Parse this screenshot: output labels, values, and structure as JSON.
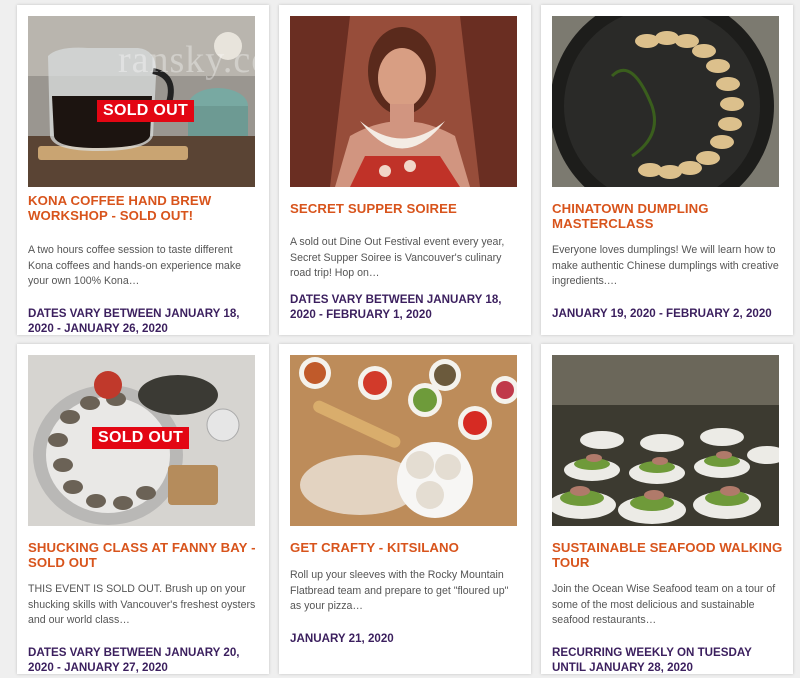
{
  "watermark": "ransky.com",
  "sold_badge": "SOLD OUT",
  "events": [
    {
      "title": "KONA COFFEE HAND BREW WORKSHOP - SOLD OUT!",
      "description": "A two hours coffee session to taste different Kona coffees and hands-on experience make your own 100% Kona…",
      "dates": "DATES VARY BETWEEN JANUARY 18, 2020 - JANUARY 26, 2020"
    },
    {
      "title": "SECRET SUPPER SOIREE",
      "description": "A sold out Dine Out Festival event every year, Secret Supper Soiree is Vancouver's culinary road trip! Hop on…",
      "dates": "DATES VARY BETWEEN JANUARY 18, 2020 - FEBRUARY 1, 2020"
    },
    {
      "title": "CHINATOWN DUMPLING MASTERCLASS",
      "description": "Everyone loves dumplings! We will learn how to make authentic Chinese dumplings with creative ingredients.…",
      "dates": "JANUARY 19, 2020 - FEBRUARY 2, 2020"
    },
    {
      "title": "SHUCKING CLASS AT FANNY BAY - SOLD OUT",
      "description": "THIS EVENT IS SOLD OUT. Brush up on your shucking skills with Vancouver's freshest oysters and our world class…",
      "dates": "DATES VARY BETWEEN JANUARY 20, 2020 - JANUARY 27, 2020"
    },
    {
      "title": "GET CRAFTY - KITSILANO",
      "description": "Roll up your sleeves with the Rocky Mountain Flatbread team and prepare to get \"floured up\" as your pizza…",
      "dates": "JANUARY 21, 2020"
    },
    {
      "title": "SUSTAINABLE SEAFOOD WALKING TOUR",
      "description": "Join the Ocean Wise Seafood team on a tour of some of the most delicious and sustainable seafood restaurants…",
      "dates": "RECURRING WEEKLY ON TUESDAY UNTIL JANUARY 28, 2020"
    }
  ],
  "colors": {
    "title": "#d8541c",
    "date": "#3b1f5e",
    "badge": "#e30613"
  }
}
